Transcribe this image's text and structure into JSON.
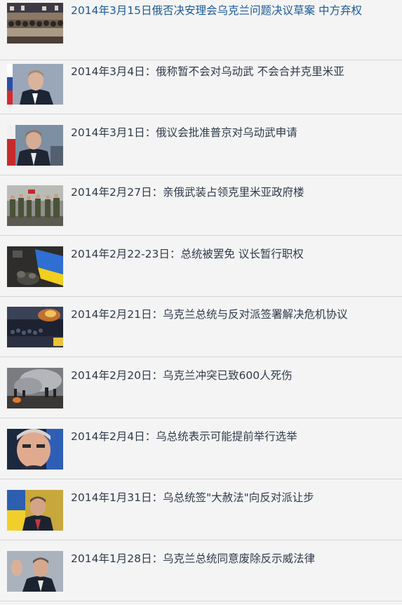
{
  "news": {
    "items": [
      {
        "title": "2014年3月15日俄否决安理会乌克兰问题决议草案 中方弃权",
        "thumb": "un-security-council-photo"
      },
      {
        "title": "2014年3月4日：俄称暂不会对乌动武 不会合并克里米亚",
        "thumb": "putin-press-photo"
      },
      {
        "title": "2014年3月1日：俄议会批准普京对乌动武申请",
        "thumb": "putin-portrait-photo"
      },
      {
        "title": "2014年2月27日：亲俄武装占领克里米亚政府楼",
        "thumb": "armed-men-photo"
      },
      {
        "title": "2014年2月22-23日：总统被罢免 议长暂行职权",
        "thumb": "ukraine-flag-protest-photo"
      },
      {
        "title": "2014年2月21日：乌克兰总统与反对派签署解决危机协议",
        "thumb": "kiev-night-protest-photo"
      },
      {
        "title": "2014年2月20日：乌克兰冲突已致600人死伤",
        "thumb": "clash-smoke-photo"
      },
      {
        "title": "2014年2月4日：乌总统表示可能提前举行选举",
        "thumb": "yanukovych-closeup-photo"
      },
      {
        "title": "2014年1月31日：乌总统签\"大赦法\"向反对派让步",
        "thumb": "yanukovych-flag-photo"
      },
      {
        "title": "2014年1月28日：乌克兰总统同意废除反示威法律",
        "thumb": "yanukovych-wave-photo"
      }
    ]
  }
}
